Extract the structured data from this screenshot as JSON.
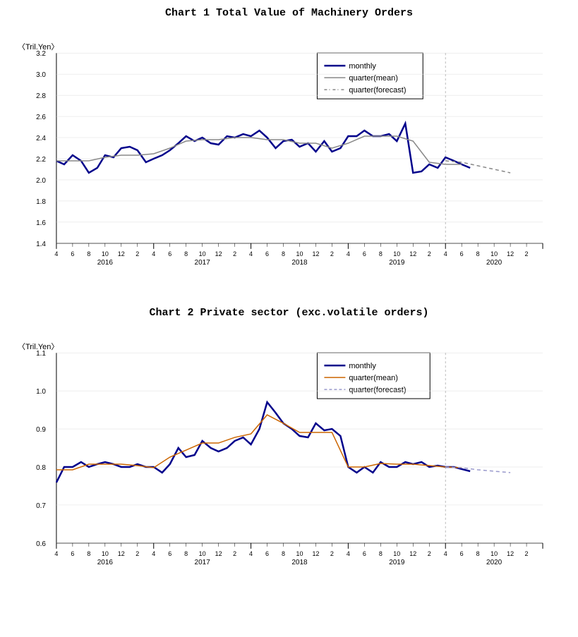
{
  "chart1": {
    "title": "Chart 1  Total Value of Machinery Orders",
    "yUnit": "〈Tril.Yen〉",
    "yMax": 3.2,
    "yMin": 1.4,
    "legend": {
      "monthly": "monthly",
      "quarterMean": "quarter(mean)",
      "quarterForecast": "quarter(forecast)"
    },
    "colors": {
      "monthly": "#00008B",
      "quarterMean": "#808080",
      "quarterForecast": "#808080"
    }
  },
  "chart2": {
    "title": "Chart 2  Private sector (exc.volatile orders)",
    "yUnit": "〈Tril.Yen〉",
    "yMax": 1.1,
    "yMin": 0.6,
    "legend": {
      "monthly": "monthly",
      "quarterMean": "quarter(mean)",
      "quarterForecast": "quarter(forecast)"
    },
    "colors": {
      "monthly": "#00008B",
      "quarterMean": "#CC6600",
      "quarterForecast": "#9999CC"
    }
  }
}
